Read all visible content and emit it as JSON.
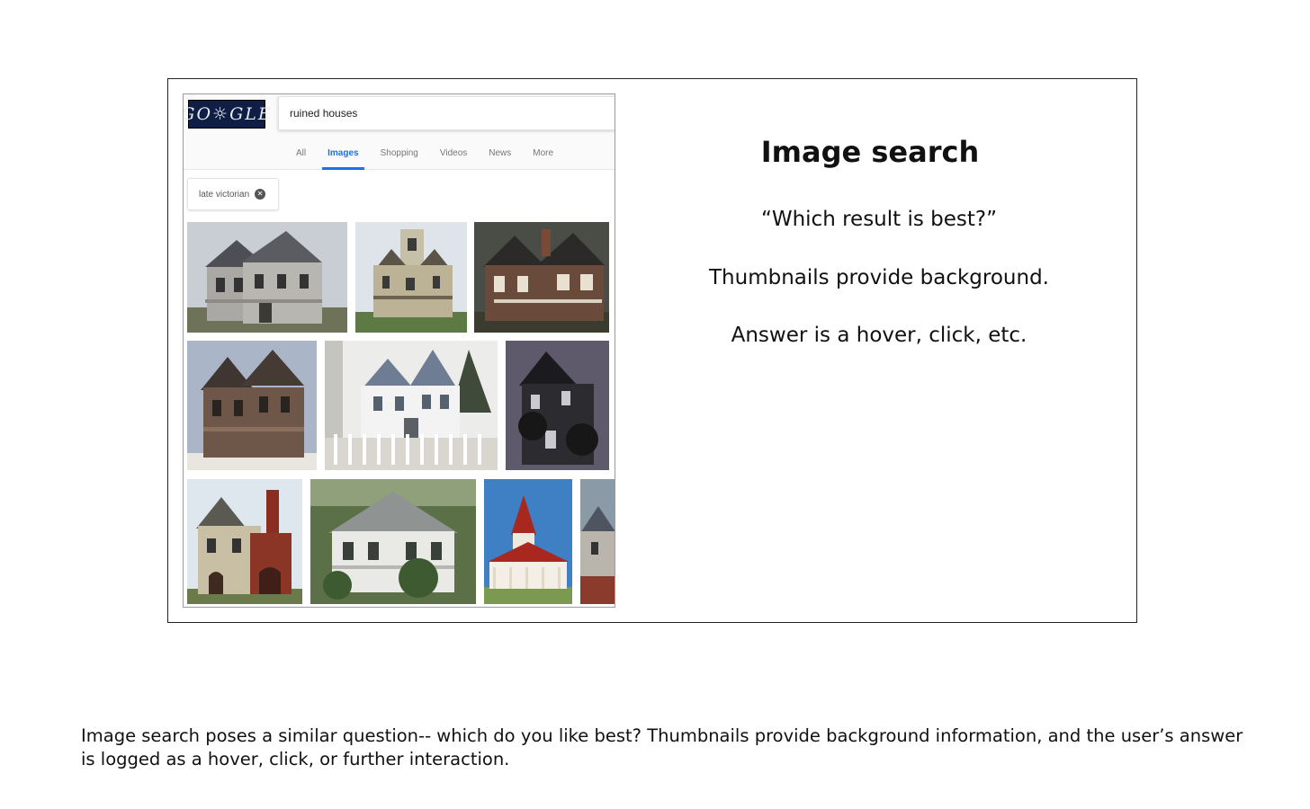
{
  "slide": {
    "heading": "Image search",
    "lines": [
      "“Which result is best?”",
      "Thumbnails provide background.",
      "Answer is a hover, click, etc."
    ]
  },
  "search": {
    "logo_text": "GO☼GLE",
    "query": "ruined houses",
    "tabs": [
      {
        "label": "All",
        "active": false
      },
      {
        "label": "Images",
        "active": true
      },
      {
        "label": "Shopping",
        "active": false
      },
      {
        "label": "Videos",
        "active": false
      },
      {
        "label": "News",
        "active": false
      },
      {
        "label": "More",
        "active": false
      }
    ],
    "filter_chip": "late victorian",
    "accent_color": "#1a73e8"
  },
  "thumbnails": [
    {
      "subject": "weathered gray two-story victorian house"
    },
    {
      "subject": "abandoned victorian house with square tower"
    },
    {
      "subject": "dark brick ruined victorian manor"
    },
    {
      "subject": "brown stone gothic victorian mansion"
    },
    {
      "subject": "white gothic house with picket fence"
    },
    {
      "subject": "dark vine-covered victorian house"
    },
    {
      "subject": "red brick victorian house with chimney"
    },
    {
      "subject": "white overgrown victorian house"
    },
    {
      "subject": "victorian house with red turret roof"
    },
    {
      "subject": "partial house thumbnail"
    }
  ],
  "caption": "Image search poses a similar question-- which do you like best?  Thumbnails provide background information, and the user’s answer is logged as a hover, click, or further interaction."
}
